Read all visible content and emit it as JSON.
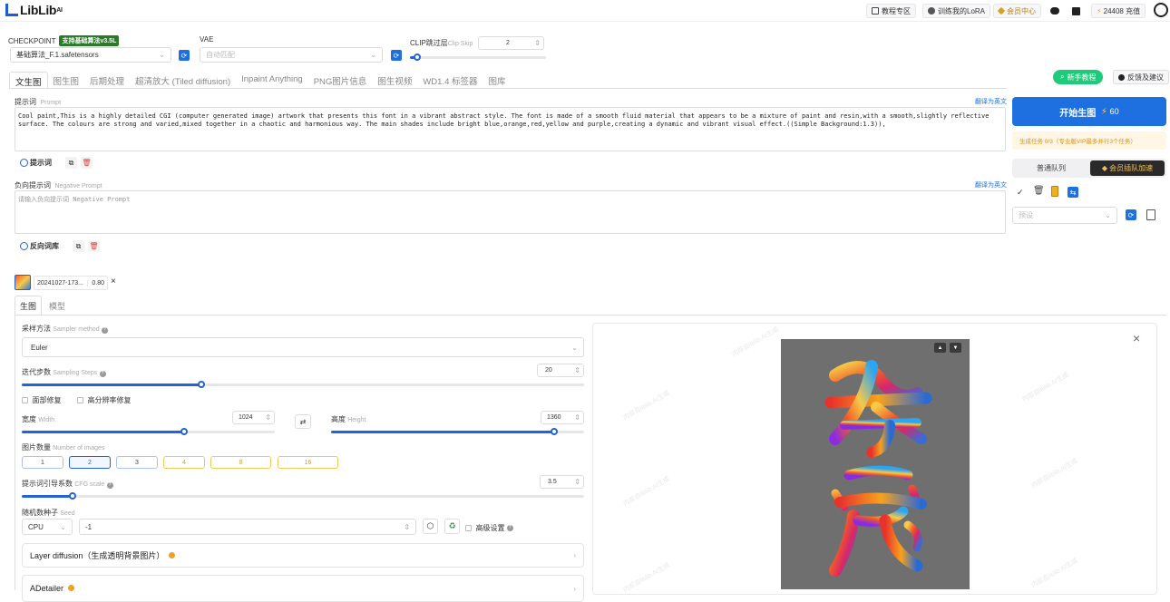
{
  "brand": {
    "name": "LibLib",
    "suffix": "AI"
  },
  "topnav": {
    "tutorial": "教程专区",
    "train": "训练我的LoRA",
    "vip": "会员中心",
    "credits": "24408",
    "recharge": "充值"
  },
  "checkpoint": {
    "label": "CHECKPOINT",
    "badge": "支持基础算法v3.5L",
    "value": "基础算法_F.1.safetensors"
  },
  "vae": {
    "label": "VAE",
    "placeholder": "自动匹配"
  },
  "clip": {
    "label": "CLIP跳过层",
    "sub": "Clip Skip",
    "value": "2",
    "fraction": 0.05
  },
  "tabs": [
    "文生图",
    "图生图",
    "后期处理",
    "超清放大 (Tiled diffusion)",
    "Inpaint Anything",
    "PNG图片信息",
    "图生视频",
    "WD1.4 标签器",
    "图库"
  ],
  "help": {
    "tutorial": "新手教程",
    "feedback": "反馈及建议"
  },
  "prompt": {
    "label": "提示词",
    "sub": "Prompt",
    "translate": "翻译为英文",
    "text": "Cool paint,This is a highly detailed CGI (computer generated image) artwork that presents this font in a vibrant abstract style. The font is made of a smooth fluid material that appears to be a mixture of paint and resin,with a smooth,slightly reflective surface. The colours are strong and varied,mixed together in a chaotic and harmonious way. The main shades include bright blue,orange,red,yellow and purple,creating a dynamic and vibrant visual effect.((Simple Background:1.3)),",
    "lib": "提示词"
  },
  "negative": {
    "label": "负向提示词",
    "sub": "Negative Prompt",
    "translate": "翻译为英文",
    "placeholder": "请输入负向提示词 Negative Prompt",
    "lib": "反向词库"
  },
  "generate": {
    "button": "开始生图",
    "cost": "60",
    "task_info": "生成任务 0/3（专业版VIP最多并行3个任务）",
    "queue_normal": "普通队列",
    "queue_vip": "会员插队加速",
    "preset_placeholder": "预设"
  },
  "lora": {
    "name": "20241027-173...",
    "weight": "0.80"
  },
  "subtabs": [
    "生图",
    "模型"
  ],
  "sampler": {
    "label": "采样方法",
    "sub": "Sampler method",
    "value": "Euler"
  },
  "steps": {
    "label": "迭代步数",
    "sub": "Sampling Steps",
    "value": "20",
    "fraction": 0.32
  },
  "restore": {
    "face": "面部修复",
    "hires": "高分辨率修复"
  },
  "width": {
    "label": "宽度",
    "sub": "Width",
    "value": "1024",
    "fraction": 0.64
  },
  "height": {
    "label": "高度",
    "sub": "Height",
    "value": "1360",
    "fraction": 0.88
  },
  "batch": {
    "label": "图片数量",
    "sub": "Number of images",
    "options": [
      "1",
      "2",
      "3",
      "4",
      "8",
      "16"
    ],
    "selected": "2"
  },
  "cfg": {
    "label": "提示词引导系数",
    "sub": "CFG scale",
    "value": "3.5",
    "fraction": 0.09
  },
  "seed": {
    "label": "随机数种子",
    "sub": "Seed",
    "device": "CPU",
    "value": "-1",
    "advanced": "高级设置"
  },
  "accordions": [
    {
      "title": "Layer diffusion（生成透明背景图片）"
    },
    {
      "title": "ADetailer"
    }
  ],
  "preview": {
    "watermark": "内部自liblib.AI生成"
  },
  "colors": {
    "accent": "#2561d9",
    "generate": "#1e6fe0",
    "badge": "#2a7a2a",
    "tutorial": "#1ecb7a"
  }
}
